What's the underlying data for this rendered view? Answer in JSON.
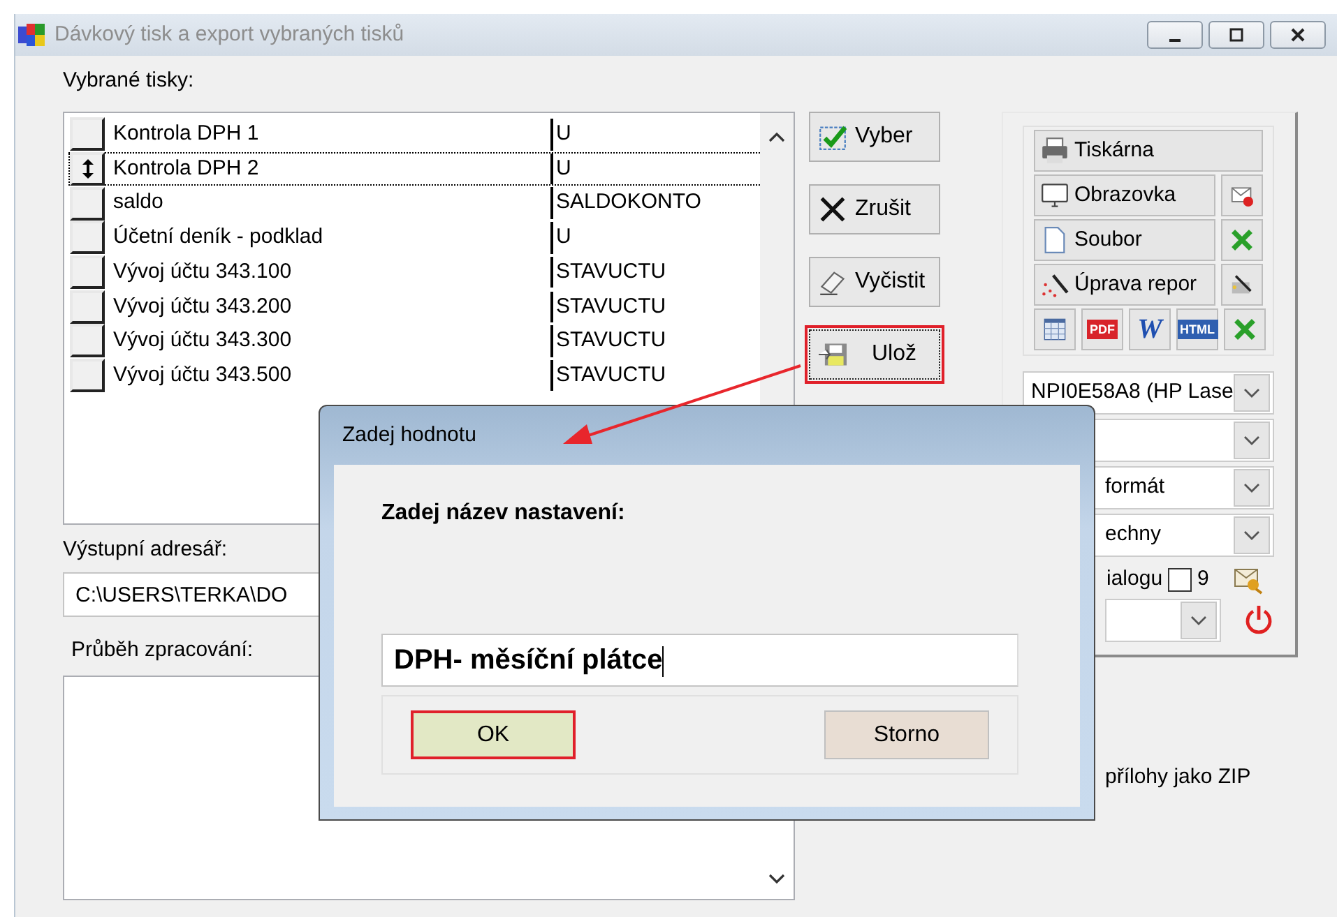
{
  "window": {
    "title": "Dávkový tisk a export vybraných tisků"
  },
  "selected_prints": {
    "label": "Vybrané tisky:",
    "rows": [
      {
        "name": "Kontrola DPH 1",
        "code": "U",
        "focused": false
      },
      {
        "name": "Kontrola DPH 2",
        "code": "U",
        "focused": true
      },
      {
        "name": "saldo",
        "code": "SALDOKONTO",
        "focused": false
      },
      {
        "name": "Účetní deník - podklad",
        "code": "U",
        "focused": false
      },
      {
        "name": "Vývoj účtu 343.100",
        "code": "STAVUCTU",
        "focused": false
      },
      {
        "name": "Vývoj účtu 343.200",
        "code": "STAVUCTU",
        "focused": false
      },
      {
        "name": "Vývoj účtu 343.300",
        "code": "STAVUCTU",
        "focused": false
      },
      {
        "name": "Vývoj účtu 343.500",
        "code": "STAVUCTU",
        "focused": false
      }
    ]
  },
  "output_dir": {
    "label": "Výstupní adresář:",
    "value": "C:\\USERS\\TERKA\\DO"
  },
  "progress": {
    "label": "Průběh zpracování:"
  },
  "actions": [
    {
      "label": "Vyber",
      "kind": "check",
      "highlighted": false
    },
    {
      "label": "Zrušit",
      "kind": "cross",
      "highlighted": false
    },
    {
      "label": "Vyčistit",
      "kind": "eraser",
      "highlighted": false
    },
    {
      "label": "Ulož",
      "kind": "disk",
      "highlighted": true
    }
  ],
  "destinations": [
    {
      "label": "Tiskárna",
      "kind": "printer"
    },
    {
      "label": "Obrazovka",
      "kind": "monitor",
      "side": {
        "kind": "email"
      }
    },
    {
      "label": "Soubor",
      "kind": "file",
      "side": {
        "kind": "excel"
      }
    },
    {
      "label": "Úprava repor",
      "kind": "wand",
      "side": {
        "kind": "wand"
      }
    }
  ],
  "formats": [
    {
      "kind": "table"
    },
    {
      "kind": "pdf",
      "text": "PDF"
    },
    {
      "kind": "word",
      "text": "W"
    },
    {
      "kind": "html",
      "text": "HTML"
    },
    {
      "kind": "excel"
    }
  ],
  "dropdowns": [
    {
      "kind": "select",
      "value": "NPI0E58A8 (HP Lase"
    },
    {
      "kind": "select"
    },
    {
      "kind": "select",
      "value": "formát"
    },
    {
      "kind": "select",
      "value": "echny"
    }
  ],
  "copies": {
    "label": "ialogu",
    "checked": false,
    "count": "9"
  },
  "zip_label": "přílohy jako ZIP",
  "dialog": {
    "title": "Zadej hodnotu",
    "prompt": "Zadej název nastavení:",
    "value": "DPH- měsíční plátce",
    "buttons": [
      {
        "label": "OK",
        "kind": "ok",
        "highlighted": true
      },
      {
        "label": "Storno",
        "kind": "cancel",
        "highlighted": false
      }
    ]
  },
  "annotation": {
    "arrow": true
  }
}
